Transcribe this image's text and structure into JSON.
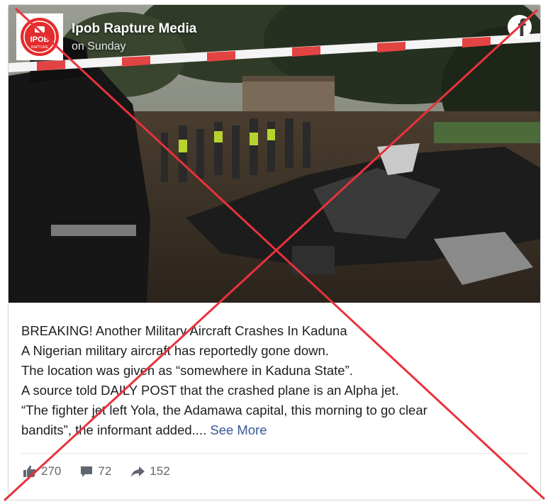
{
  "post": {
    "page_name": "Ipob Rapture Media",
    "time": "on Sunday",
    "avatar": {
      "text": "IPOB",
      "subtext": "RAPTURE",
      "color": "#e52b2b"
    },
    "network_icon": "facebook-icon",
    "body_lines": [
      "BREAKING! Another Military Aircraft Crashes In Kaduna",
      "A Nigerian military aircraft has reportedly gone down.",
      "The location was given as “somewhere in Kaduna State”.",
      "A source told DAILY POST that the crashed plane is an Alpha jet.",
      "“The fighter jet left Yola, the Adamawa capital, this morning to go clear",
      "bandits”, the informant added...."
    ],
    "see_more": "See More",
    "stats": {
      "reactions": "270",
      "comments": "72",
      "shares": "152"
    }
  },
  "overlay": {
    "type": "x-mark",
    "color": "#e8323c"
  },
  "colors": {
    "link": "#385898",
    "text": "#1c1e21",
    "meta": "#606770"
  }
}
